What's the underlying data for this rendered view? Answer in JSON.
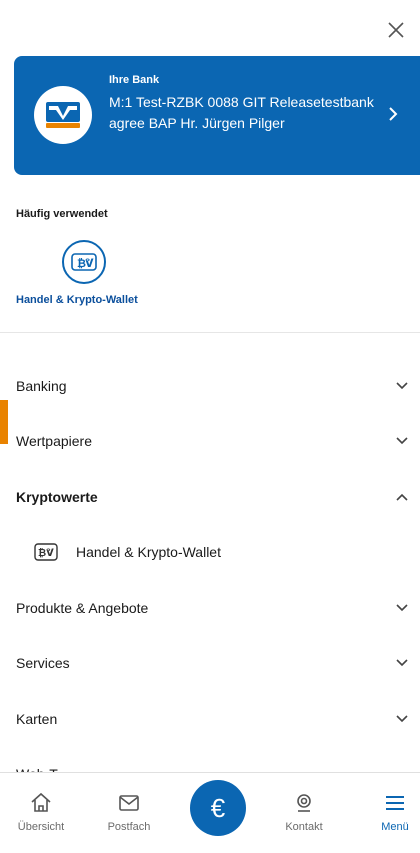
{
  "header": {
    "close_icon": "close-icon"
  },
  "bank": {
    "label": "Ihre Bank",
    "name": "M:1 Test-RZBK 0088 GIT Releasetestbank agree BAP Hr. Jürgen Pilger",
    "logo": "volksbank-logo",
    "chevron": "chevron-right-icon"
  },
  "frequent": {
    "title": "Häufig verwendet",
    "items": [
      {
        "label": "Handel & Krypto-Wallet",
        "icon": "crypto-wallet-icon"
      }
    ]
  },
  "menu": [
    {
      "label": "Banking",
      "expanded": false
    },
    {
      "label": "Wertpapiere",
      "expanded": false
    },
    {
      "label": "Kryptowerte",
      "expanded": true,
      "children": [
        {
          "label": "Handel & Krypto-Wallet"
        }
      ]
    },
    {
      "label": "Produkte & Angebote",
      "expanded": false
    },
    {
      "label": "Services",
      "expanded": false
    },
    {
      "label": "Karten",
      "expanded": false
    }
  ],
  "partial_item": "Web-T...",
  "bottom_nav": {
    "items": [
      {
        "label": "Übersicht",
        "icon": "home-icon"
      },
      {
        "label": "Postfach",
        "icon": "mail-icon"
      },
      {
        "label": "€",
        "icon": "euro-icon"
      },
      {
        "label": "Kontakt",
        "icon": "headset-icon"
      },
      {
        "label": "Menü",
        "icon": "menu-icon",
        "active": true
      }
    ]
  },
  "colors": {
    "brand_blue": "#0b66b2",
    "accent_orange": "#e98300"
  }
}
